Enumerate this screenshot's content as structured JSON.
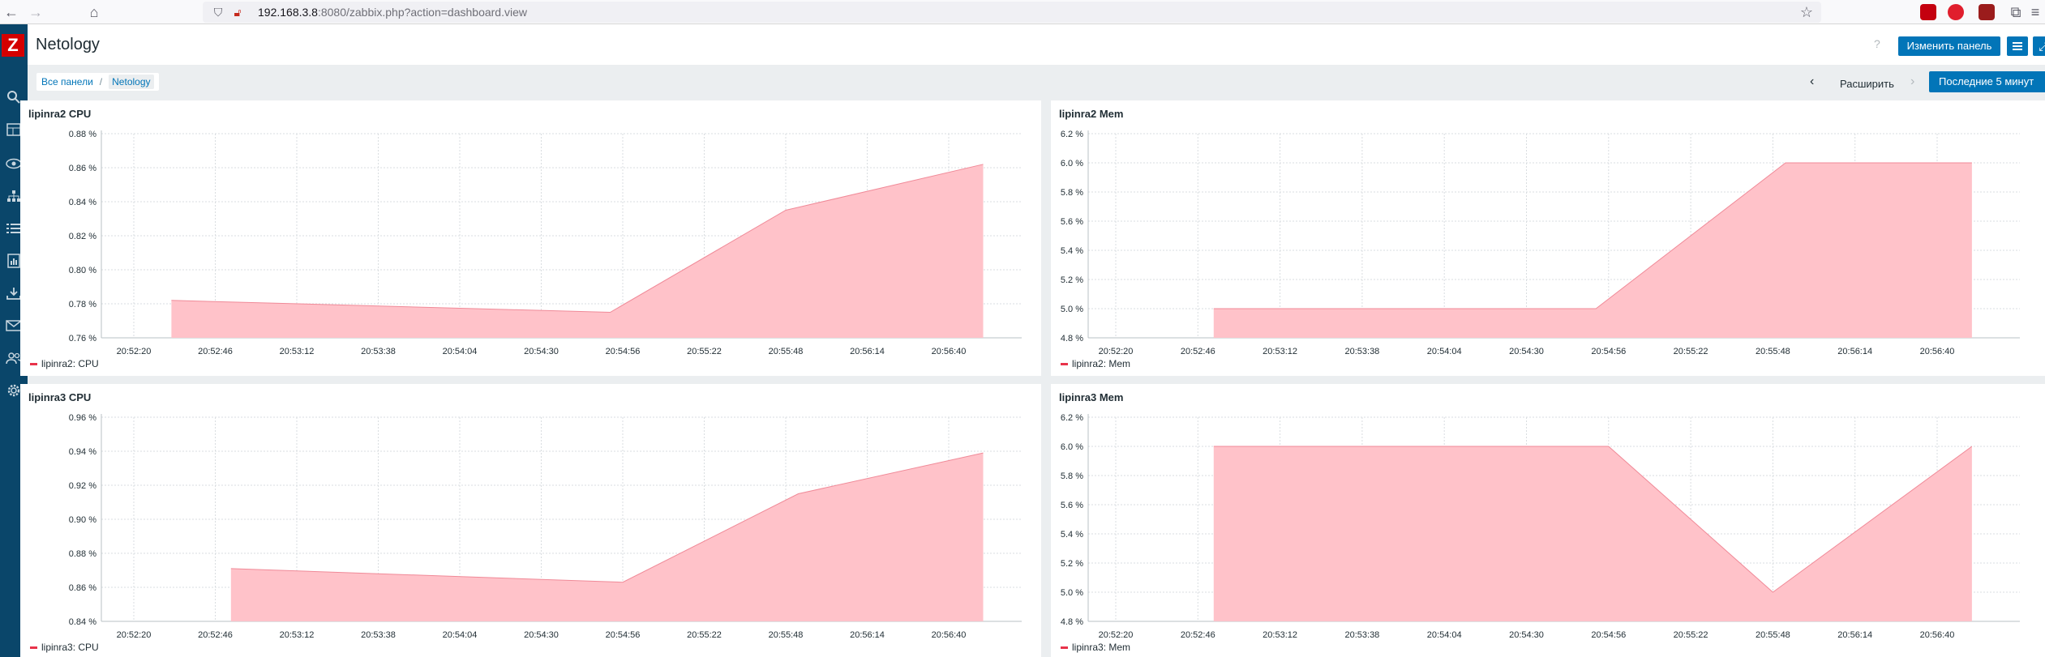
{
  "browser": {
    "url_host": "192.168.3.8",
    "url_rest": ":8080/zabbix.php?action=dashboard.view"
  },
  "header": {
    "title": "Netology",
    "help": "?",
    "edit_button": "Изменить панель"
  },
  "breadcrumb": {
    "all": "Все панели",
    "separator": "/",
    "current": "Netology"
  },
  "timebar": {
    "zoom_out": "Расширить",
    "range": "Последние 5 минут"
  },
  "colors": {
    "fill": "#ffc2c9",
    "line": "#f08a98",
    "legend": "#e8334a",
    "accent": "#0275b8"
  },
  "widgets": [
    {
      "title": "lipinra2 CPU",
      "legend": "lipinra2: CPU",
      "chart_data": {
        "type": "area",
        "y_ticks": [
          "0.88 %",
          "0.86 %",
          "0.84 %",
          "0.82 %",
          "0.80 %",
          "0.78 %",
          "0.76 %"
        ],
        "ylim": [
          0.76,
          0.88
        ],
        "x_ticks": [
          "20:52:20",
          "20:52:46",
          "20:53:12",
          "20:53:38",
          "20:54:04",
          "20:54:30",
          "20:54:56",
          "20:55:22",
          "20:55:48",
          "20:56:14",
          "20:56:40"
        ],
        "series": [
          {
            "name": "lipinra2: CPU",
            "x": [
              "20:52:32",
              "20:54:52",
              "20:55:48",
              "20:56:51"
            ],
            "values": [
              0.782,
              0.775,
              0.835,
              0.862
            ]
          }
        ]
      }
    },
    {
      "title": "lipinra2 Mem",
      "legend": "lipinra2: Mem",
      "chart_data": {
        "type": "area",
        "y_ticks": [
          "6.2 %",
          "6.0 %",
          "5.8 %",
          "5.6 %",
          "5.4 %",
          "5.2 %",
          "5.0 %",
          "4.8 %"
        ],
        "ylim": [
          4.8,
          6.2
        ],
        "x_ticks": [
          "20:52:20",
          "20:52:46",
          "20:53:12",
          "20:53:38",
          "20:54:04",
          "20:54:30",
          "20:54:56",
          "20:55:22",
          "20:55:48",
          "20:56:14",
          "20:56:40"
        ],
        "series": [
          {
            "name": "lipinra2: Mem",
            "x": [
              "20:52:51",
              "20:54:52",
              "20:55:52",
              "20:56:51"
            ],
            "values": [
              5.0,
              5.0,
              6.0,
              6.0
            ]
          }
        ]
      }
    },
    {
      "title": "lipinra3 CPU",
      "legend": "lipinra3: CPU",
      "chart_data": {
        "type": "area",
        "y_ticks": [
          "0.96 %",
          "0.94 %",
          "0.92 %",
          "0.90 %",
          "0.88 %",
          "0.86 %",
          "0.84 %"
        ],
        "ylim": [
          0.84,
          0.96
        ],
        "x_ticks": [
          "20:52:20",
          "20:52:46",
          "20:53:12",
          "20:53:38",
          "20:54:04",
          "20:54:30",
          "20:54:56",
          "20:55:22",
          "20:55:48",
          "20:56:14",
          "20:56:40"
        ],
        "series": [
          {
            "name": "lipinra3: CPU",
            "x": [
              "20:52:51",
              "20:54:56",
              "20:55:52",
              "20:56:51"
            ],
            "values": [
              0.871,
              0.863,
              0.915,
              0.939
            ]
          }
        ]
      }
    },
    {
      "title": "lipinra3 Mem",
      "legend": "lipinra3: Mem",
      "chart_data": {
        "type": "area",
        "y_ticks": [
          "6.2 %",
          "6.0 %",
          "5.8 %",
          "5.6 %",
          "5.4 %",
          "5.2 %",
          "5.0 %",
          "4.8 %"
        ],
        "ylim": [
          4.8,
          6.2
        ],
        "x_ticks": [
          "20:52:20",
          "20:52:46",
          "20:53:12",
          "20:53:38",
          "20:54:04",
          "20:54:30",
          "20:54:56",
          "20:55:22",
          "20:55:48",
          "20:56:14",
          "20:56:40"
        ],
        "series": [
          {
            "name": "lipinra3: Mem",
            "x": [
              "20:52:51",
              "20:54:56",
              "20:55:48",
              "20:56:51"
            ],
            "values": [
              6.0,
              6.0,
              5.0,
              6.0
            ]
          }
        ]
      }
    }
  ]
}
